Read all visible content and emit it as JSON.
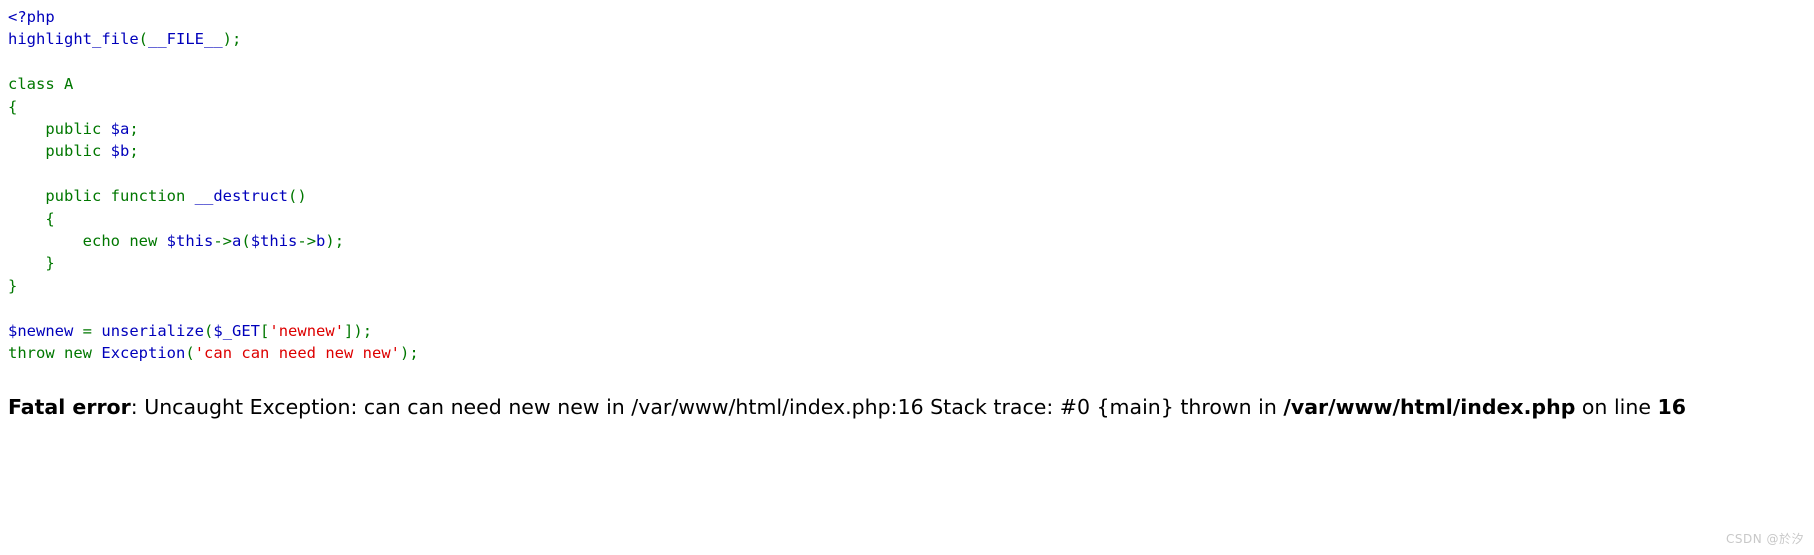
{
  "page": {
    "title": "PHP highlight_file source listing with fatal error",
    "background_color": "#ffffff",
    "watermark": "CSDN @於汐"
  },
  "theme": {
    "default_color": "#0000bb",
    "keyword_color": "#007700",
    "string_color": "#dd0000",
    "comment_color": "#ff8000",
    "html_color": "#000000",
    "error_text_color": "#000000"
  },
  "code": {
    "language": "php",
    "lines": [
      {
        "number": 1,
        "text": "<?php",
        "tokens": [
          {
            "t": "<?php",
            "c": "tag"
          }
        ]
      },
      {
        "number": 2,
        "text": "highlight_file(__FILE__);",
        "tokens": [
          {
            "t": "highlight_file",
            "c": "fn"
          },
          {
            "t": "(",
            "c": "kw"
          },
          {
            "t": "__FILE__",
            "c": "fn"
          },
          {
            "t": ")",
            "c": "kw"
          },
          {
            "t": ";",
            "c": "kw"
          }
        ]
      },
      {
        "number": 3,
        "text": "",
        "tokens": []
      },
      {
        "number": 4,
        "text": "class A",
        "tokens": [
          {
            "t": "class",
            "c": "kw"
          },
          {
            "t": " ",
            "c": "kw"
          },
          {
            "t": "A",
            "c": "kw"
          }
        ]
      },
      {
        "number": 5,
        "text": "{",
        "tokens": [
          {
            "t": "{",
            "c": "kw"
          }
        ]
      },
      {
        "number": 6,
        "text": "    public $a;",
        "tokens": [
          {
            "t": "    ",
            "c": "kw"
          },
          {
            "t": "public",
            "c": "kw"
          },
          {
            "t": " ",
            "c": "kw"
          },
          {
            "t": "$a",
            "c": "var"
          },
          {
            "t": ";",
            "c": "kw"
          }
        ]
      },
      {
        "number": 7,
        "text": "    public $b;",
        "tokens": [
          {
            "t": "    ",
            "c": "kw"
          },
          {
            "t": "public",
            "c": "kw"
          },
          {
            "t": " ",
            "c": "kw"
          },
          {
            "t": "$b",
            "c": "var"
          },
          {
            "t": ";",
            "c": "kw"
          }
        ]
      },
      {
        "number": 8,
        "text": "",
        "tokens": []
      },
      {
        "number": 9,
        "text": "    public function __destruct()",
        "tokens": [
          {
            "t": "    ",
            "c": "kw"
          },
          {
            "t": "public",
            "c": "kw"
          },
          {
            "t": " ",
            "c": "kw"
          },
          {
            "t": "function",
            "c": "kw"
          },
          {
            "t": " ",
            "c": "kw"
          },
          {
            "t": "__destruct",
            "c": "fn"
          },
          {
            "t": "(",
            "c": "kw"
          },
          {
            "t": ")",
            "c": "kw"
          }
        ]
      },
      {
        "number": 10,
        "text": "    {",
        "tokens": [
          {
            "t": "    ",
            "c": "kw"
          },
          {
            "t": "{",
            "c": "kw"
          }
        ]
      },
      {
        "number": 11,
        "text": "        echo new $this->a($this->b);",
        "tokens": [
          {
            "t": "        ",
            "c": "kw"
          },
          {
            "t": "echo",
            "c": "kw"
          },
          {
            "t": " ",
            "c": "kw"
          },
          {
            "t": "new",
            "c": "kw"
          },
          {
            "t": " ",
            "c": "kw"
          },
          {
            "t": "$this",
            "c": "var"
          },
          {
            "t": "->",
            "c": "kw"
          },
          {
            "t": "a",
            "c": "fn"
          },
          {
            "t": "(",
            "c": "kw"
          },
          {
            "t": "$this",
            "c": "var"
          },
          {
            "t": "->",
            "c": "kw"
          },
          {
            "t": "b",
            "c": "fn"
          },
          {
            "t": ")",
            "c": "kw"
          },
          {
            "t": ";",
            "c": "kw"
          }
        ]
      },
      {
        "number": 12,
        "text": "    }",
        "tokens": [
          {
            "t": "    ",
            "c": "kw"
          },
          {
            "t": "}",
            "c": "kw"
          }
        ]
      },
      {
        "number": 13,
        "text": "}",
        "tokens": [
          {
            "t": "}",
            "c": "kw"
          }
        ]
      },
      {
        "number": 14,
        "text": "",
        "tokens": []
      },
      {
        "number": 15,
        "text": "$newnew = unserialize($_GET['newnew']);",
        "tokens": [
          {
            "t": "$newnew",
            "c": "var"
          },
          {
            "t": " ",
            "c": "kw"
          },
          {
            "t": "=",
            "c": "kw"
          },
          {
            "t": " ",
            "c": "kw"
          },
          {
            "t": "unserialize",
            "c": "fn"
          },
          {
            "t": "(",
            "c": "kw"
          },
          {
            "t": "$_GET",
            "c": "var"
          },
          {
            "t": "[",
            "c": "kw"
          },
          {
            "t": "'newnew'",
            "c": "str"
          },
          {
            "t": "]",
            "c": "kw"
          },
          {
            "t": ")",
            "c": "kw"
          },
          {
            "t": ";",
            "c": "kw"
          }
        ]
      },
      {
        "number": 16,
        "text": "throw new Exception('can can need new new');",
        "tokens": [
          {
            "t": "throw",
            "c": "kw"
          },
          {
            "t": " ",
            "c": "kw"
          },
          {
            "t": "new",
            "c": "kw"
          },
          {
            "t": " ",
            "c": "kw"
          },
          {
            "t": "Exception",
            "c": "fn"
          },
          {
            "t": "(",
            "c": "kw"
          },
          {
            "t": "'can can need new new'",
            "c": "str"
          },
          {
            "t": ")",
            "c": "kw"
          },
          {
            "t": ";",
            "c": "kw"
          }
        ]
      }
    ]
  },
  "error": {
    "label": "Fatal error",
    "separator": ": ",
    "message": "Uncaught Exception: can can need new new in /var/www/html/index.php:16 Stack trace: #0 {main} thrown in ",
    "file": "/var/www/html/index.php",
    "on_line_prefix": " on line ",
    "line_number": "16",
    "full_text": "Fatal error: Uncaught Exception: can can need new new in /var/www/html/index.php:16 Stack trace: #0 {main} thrown in /var/www/html/index.php on line 16"
  }
}
